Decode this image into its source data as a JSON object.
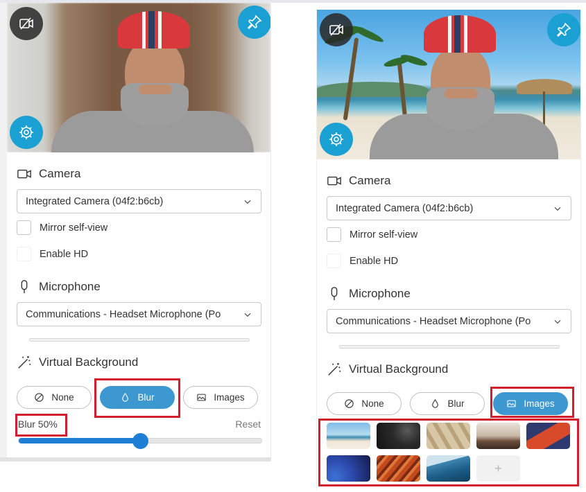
{
  "left": {
    "camera": {
      "heading": "Camera",
      "device": "Integrated Camera (04f2:b6cb)"
    },
    "mirror_label": "Mirror self-view",
    "hd_label": "Enable HD",
    "microphone": {
      "heading": "Microphone",
      "device": "Communications - Headset Microphone (Po"
    },
    "virtual_background": {
      "heading": "Virtual Background",
      "options": [
        "None",
        "Blur",
        "Images"
      ],
      "selected": "Blur",
      "blur_label": "Blur 50%",
      "blur_percent": 50,
      "reset_label": "Reset"
    }
  },
  "right": {
    "camera": {
      "heading": "Camera",
      "device": "Integrated Camera (04f2:b6cb)"
    },
    "mirror_label": "Mirror self-view",
    "hd_label": "Enable HD",
    "microphone": {
      "heading": "Microphone",
      "device": "Communications - Headset Microphone (Po"
    },
    "virtual_background": {
      "heading": "Virtual Background",
      "options": [
        "None",
        "Blur",
        "Images"
      ],
      "selected": "Images",
      "add_label": "+"
    }
  },
  "icons": [
    "video-off-icon",
    "pin-icon",
    "settings-icon",
    "camera-icon",
    "microphone-icon",
    "magic-wand-icon",
    "none-icon",
    "blur-drop-icon",
    "image-icon",
    "chevron-down-icon"
  ],
  "colors": {
    "accent": "#3d98d0",
    "slider": "#1f7fd4",
    "pin_button": "#1ba0d4",
    "highlight": "#d21f2b"
  }
}
